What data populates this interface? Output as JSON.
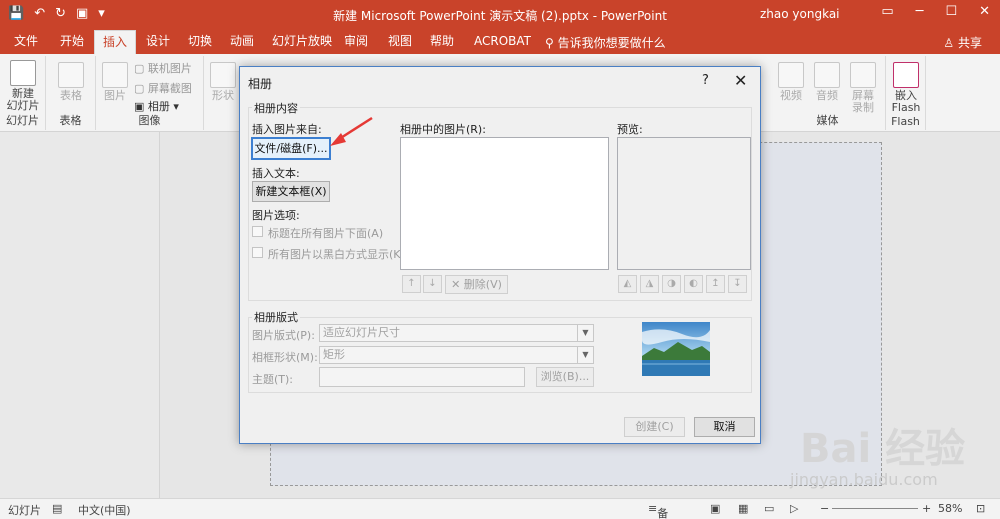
{
  "window": {
    "title": "新建 Microsoft PowerPoint 演示文稿 (2).pptx  -  PowerPoint",
    "user": "zhao yongkai",
    "controls": [
      "▭",
      "─",
      "☐",
      "✕"
    ]
  },
  "ribbon": {
    "tabs": [
      "文件",
      "开始",
      "插入",
      "设计",
      "切换",
      "动画",
      "幻灯片放映",
      "审阅",
      "视图",
      "帮助",
      "ACROBAT"
    ],
    "active_tab": "插入",
    "tell_me": "告诉我你想要做什么",
    "share": "共享",
    "groups": {
      "slides": {
        "button": "新建\n幻灯片",
        "label": "幻灯片"
      },
      "tables": {
        "button": "表格",
        "label": "表格"
      },
      "images": {
        "picture": "图片",
        "online": "联机图片",
        "screenshot": "屏幕截图",
        "album": "相册",
        "label": "图像"
      },
      "shapes": "形状",
      "media": {
        "video": "视频",
        "audio": "音频",
        "record": "屏幕\n录制",
        "label": "媒体"
      },
      "flash": {
        "button": "嵌入\nFlash",
        "label": "Flash"
      }
    }
  },
  "status": {
    "slide": "幻灯片",
    "language": "中文(中国)",
    "notes": "备注",
    "zoom": "58%"
  },
  "dialog": {
    "title": "相册",
    "help": "?",
    "close": "✕",
    "album_content_legend": "相册内容",
    "insert_picture_from": "插入图片来自:",
    "file_disk_button": "文件/磁盘(F)...",
    "insert_text": "插入文本:",
    "new_textbox_button": "新建文本框(X)",
    "picture_options": "图片选项:",
    "caption_below": "标题在所有图片下面(A)",
    "black_white": "所有图片以黑白方式显示(K)",
    "pictures_in_album": "相册中的图片(R):",
    "preview": "预览:",
    "remove_button": "删除(V)",
    "layout_legend": "相册版式",
    "picture_layout_label": "图片版式(P):",
    "picture_layout_value": "适应幻灯片尺寸",
    "frame_shape_label": "相框形状(M):",
    "frame_shape_value": "矩形",
    "theme_label": "主题(T):",
    "browse_button": "浏览(B)...",
    "create_button": "创建(C)",
    "cancel_button": "取消"
  },
  "watermark": {
    "main": "Bai 经验",
    "sub": "jingyan.baidu.com"
  },
  "colors": {
    "accent": "#c9432a",
    "dialog_border": "#4a7fc4",
    "annotation": "#e53935"
  }
}
